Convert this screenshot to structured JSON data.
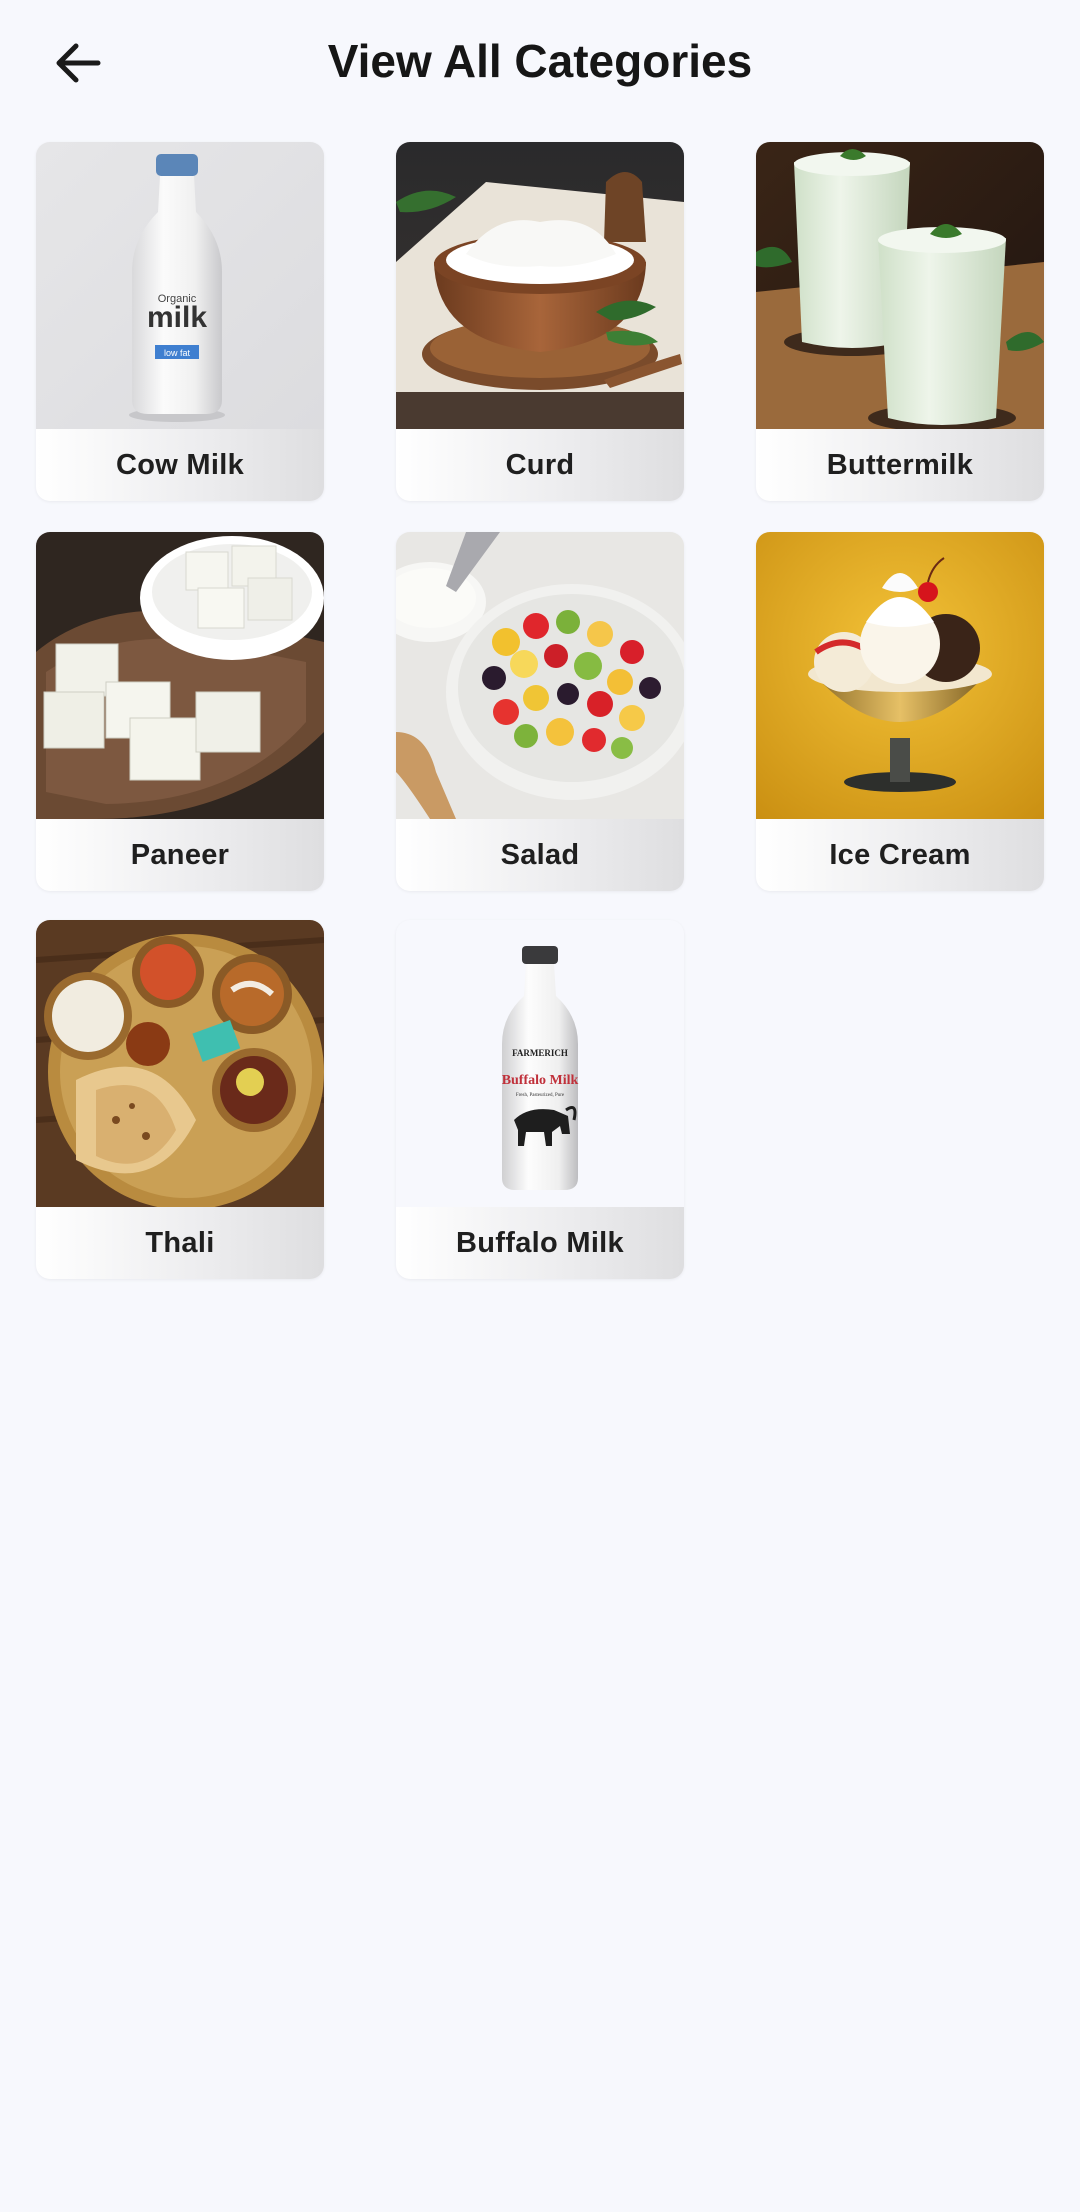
{
  "header": {
    "title": "View All Categories",
    "back_icon": "arrow-left-icon"
  },
  "categories": [
    {
      "label": "Cow Milk",
      "image": "cow-milk-image"
    },
    {
      "label": "Curd",
      "image": "curd-image"
    },
    {
      "label": "Buttermilk",
      "image": "buttermilk-image"
    },
    {
      "label": "Paneer",
      "image": "paneer-image"
    },
    {
      "label": "Salad",
      "image": "salad-image"
    },
    {
      "label": "Ice Cream",
      "image": "ice-cream-image"
    },
    {
      "label": "Thali",
      "image": "thali-image"
    },
    {
      "label": "Buffalo Milk",
      "image": "buffalo-milk-image"
    }
  ],
  "images": {
    "cow_milk": {
      "brand_small": "Organic",
      "brand": "milk",
      "tag": "low fat"
    },
    "buffalo_milk": {
      "brand": "FARMERICH",
      "name": "Buffalo Milk",
      "sub": "Fresh, Pasteurized, Pure"
    }
  }
}
